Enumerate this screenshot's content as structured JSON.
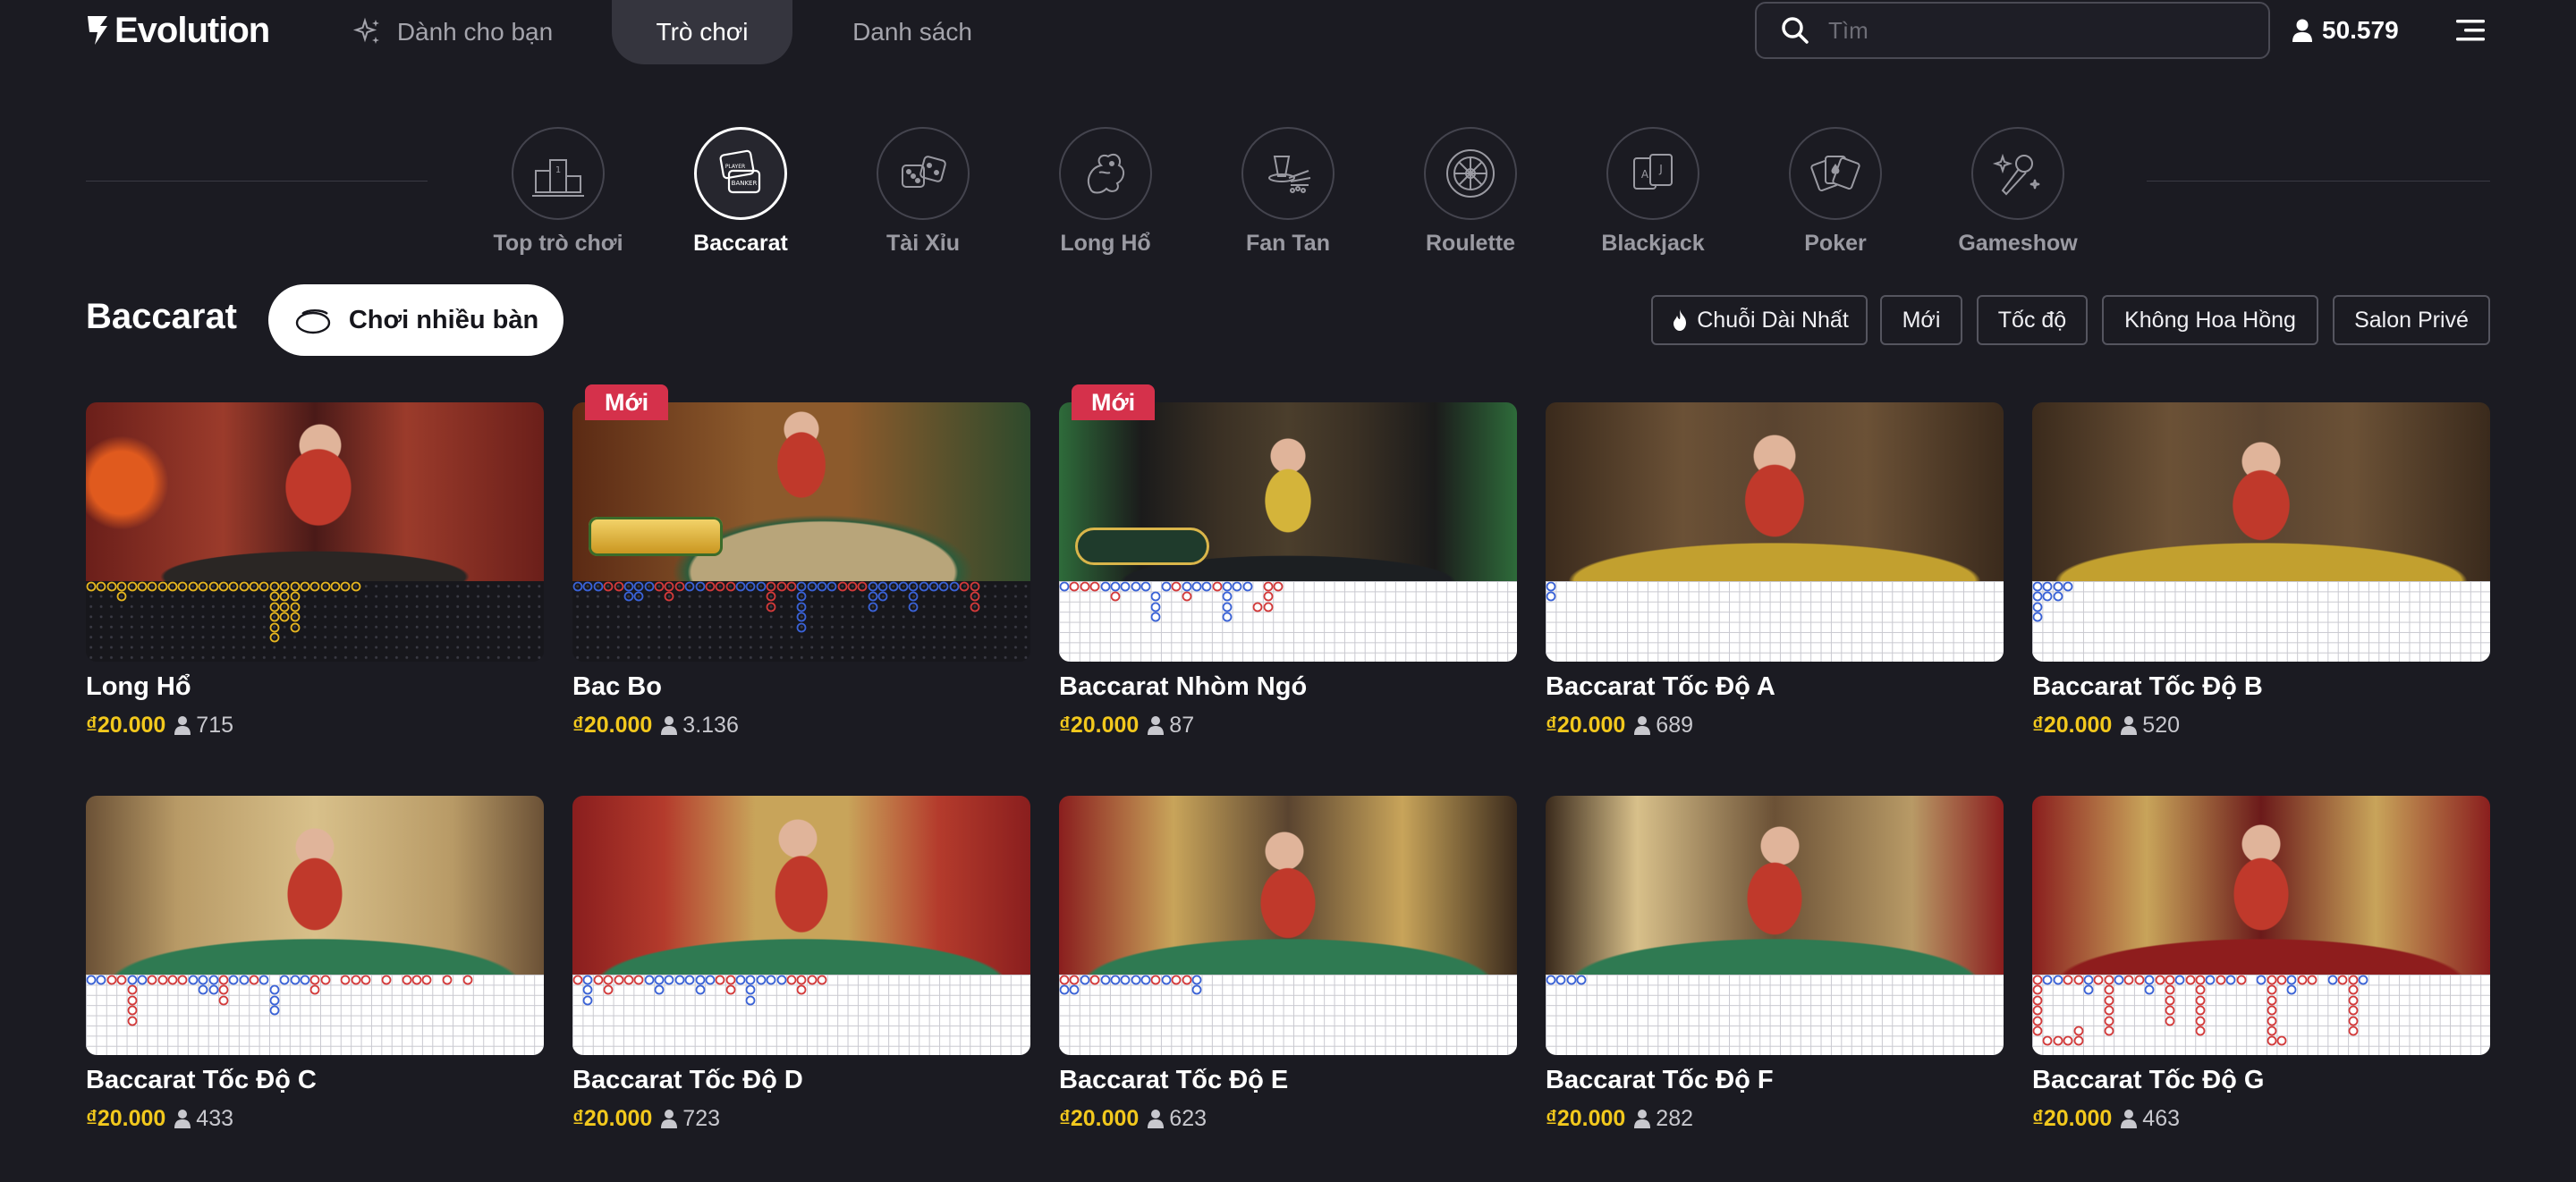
{
  "header": {
    "logo_text": "Evolution",
    "nav": {
      "for_you": "Dành cho bạn",
      "games": "Trò chơi",
      "list": "Danh sách"
    },
    "search_placeholder": "Tìm",
    "online_players": "50.579"
  },
  "categories": [
    {
      "label": "Top trò chơi",
      "icon": "podium-icon",
      "active": false
    },
    {
      "label": "Baccarat",
      "icon": "baccarat-cards-icon",
      "active": true
    },
    {
      "label": "Tài Xỉu",
      "icon": "dice-icon",
      "active": false
    },
    {
      "label": "Long Hổ",
      "icon": "dragon-tiger-icon",
      "active": false
    },
    {
      "label": "Fan Tan",
      "icon": "fan-tan-icon",
      "active": false
    },
    {
      "label": "Roulette",
      "icon": "roulette-wheel-icon",
      "active": false
    },
    {
      "label": "Blackjack",
      "icon": "blackjack-cards-icon",
      "active": false
    },
    {
      "label": "Poker",
      "icon": "poker-cards-icon",
      "active": false
    },
    {
      "label": "Gameshow",
      "icon": "gameshow-microphone-icon",
      "active": false
    }
  ],
  "section": {
    "title": "Baccarat",
    "multi_table": "Chơi nhiều bàn",
    "filters": [
      "Chuỗi Dài Nhất",
      "Mới",
      "Tốc độ",
      "Không Hoa Hồng",
      "Salon Privé"
    ]
  },
  "games": [
    {
      "name": "Long Hổ",
      "bet": "₫20.000",
      "players": "715",
      "badge": "",
      "theme": "dragon"
    },
    {
      "name": "Bac Bo",
      "bet": "₫20.000",
      "players": "3.136",
      "badge": "Mới",
      "theme": "bacbo"
    },
    {
      "name": "Baccarat Nhòm Ngó",
      "bet": "₫20.000",
      "players": "87",
      "badge": "Mới",
      "theme": "peek"
    },
    {
      "name": "Baccarat Tốc Độ A",
      "bet": "₫20.000",
      "players": "689",
      "badge": "",
      "theme": "gold"
    },
    {
      "name": "Baccarat Tốc Độ B",
      "bet": "₫20.000",
      "players": "520",
      "badge": "",
      "theme": "gold"
    },
    {
      "name": "Baccarat Tốc Độ C",
      "bet": "₫20.000",
      "players": "433",
      "badge": "",
      "theme": "green"
    },
    {
      "name": "Baccarat Tốc Độ D",
      "bet": "₫20.000",
      "players": "723",
      "badge": "",
      "theme": "greenred"
    },
    {
      "name": "Baccarat Tốc Độ E",
      "bet": "₫20.000",
      "players": "623",
      "badge": "",
      "theme": "green"
    },
    {
      "name": "Baccarat Tốc Độ F",
      "bet": "₫20.000",
      "players": "282",
      "badge": "",
      "theme": "green"
    },
    {
      "name": "Baccarat Tốc Độ G",
      "bet": "₫20.000",
      "players": "463",
      "badge": "",
      "theme": "red"
    }
  ],
  "colors": {
    "background": "#1b1b22",
    "bet_yellow": "#f2c81d",
    "new_badge": "#d5314b",
    "banker_red": "#d33a3a",
    "player_blue": "#3a62d6"
  }
}
